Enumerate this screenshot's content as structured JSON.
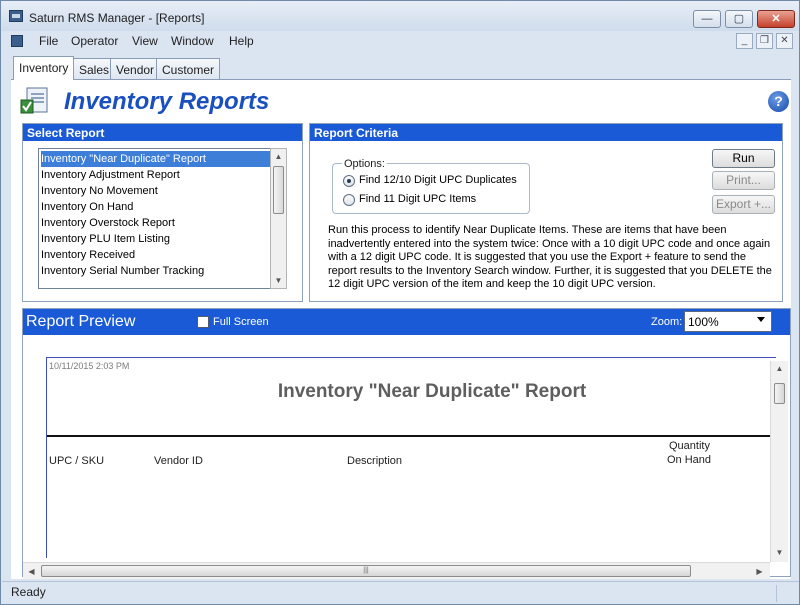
{
  "window": {
    "title": "Saturn RMS Manager - [Reports]",
    "minimize": "—",
    "maximize": "▢",
    "close": "✕"
  },
  "menu": [
    "File",
    "Operator",
    "View",
    "Window",
    "Help"
  ],
  "mdi_controls": {
    "minimize": "_",
    "restore": "❐",
    "close": "✕"
  },
  "tabs": [
    {
      "label": "Inventory",
      "active": true
    },
    {
      "label": "Sales",
      "active": false
    },
    {
      "label": "Vendor",
      "active": false
    },
    {
      "label": "Customer",
      "active": false
    }
  ],
  "header": {
    "title": "Inventory Reports",
    "help_icon": "?"
  },
  "select_report": {
    "title": "Select Report",
    "items": [
      "Inventory \"Near Duplicate\" Report",
      "Inventory Adjustment Report",
      "Inventory No Movement",
      "Inventory On Hand",
      "Inventory Overstock Report",
      "Inventory PLU Item Listing",
      "Inventory Received",
      "Inventory Serial Number Tracking"
    ],
    "selected_index": 0
  },
  "criteria": {
    "title": "Report Criteria",
    "options_label": "Options:",
    "options": [
      {
        "label": "Find 12/10 Digit UPC Duplicates",
        "checked": true
      },
      {
        "label": "Find 11 Digit UPC Items",
        "checked": false
      }
    ],
    "buttons": {
      "run": "Run",
      "print": "Print...",
      "export": "Export +..."
    },
    "description": "Run this process to identify Near Duplicate Items.  These are items that have been inadvertently entered into the system twice:  Once with a 10 digit UPC code and once again with a 12 digit UPC code.   It is suggested that you use the Export + feature to send the report results to the Inventory Search window.  Further, it is suggested that you DELETE the 12 digit UPC version of the item and keep the 10 digit UPC version."
  },
  "preview": {
    "title": "Report Preview",
    "full_screen_label": "Full Screen",
    "full_screen_checked": false,
    "zoom_label": "Zoom:",
    "zoom_value": "100%",
    "report": {
      "timestamp": "10/11/2015 2:03 PM",
      "title": "Inventory \"Near Duplicate\" Report",
      "columns": {
        "upc": "UPC / SKU",
        "vendor": "Vendor ID",
        "description": "Description",
        "qty_line1": "Quantity",
        "qty_line2": "On Hand"
      }
    }
  },
  "status": {
    "text": "Ready"
  },
  "icons": {
    "app": "app-icon",
    "logo": "inventory-reports-logo-icon",
    "help": "help-icon"
  },
  "colors": {
    "accent": "#1a5ad6",
    "heading": "#1a4fc0",
    "selection": "#3d7ed9"
  }
}
